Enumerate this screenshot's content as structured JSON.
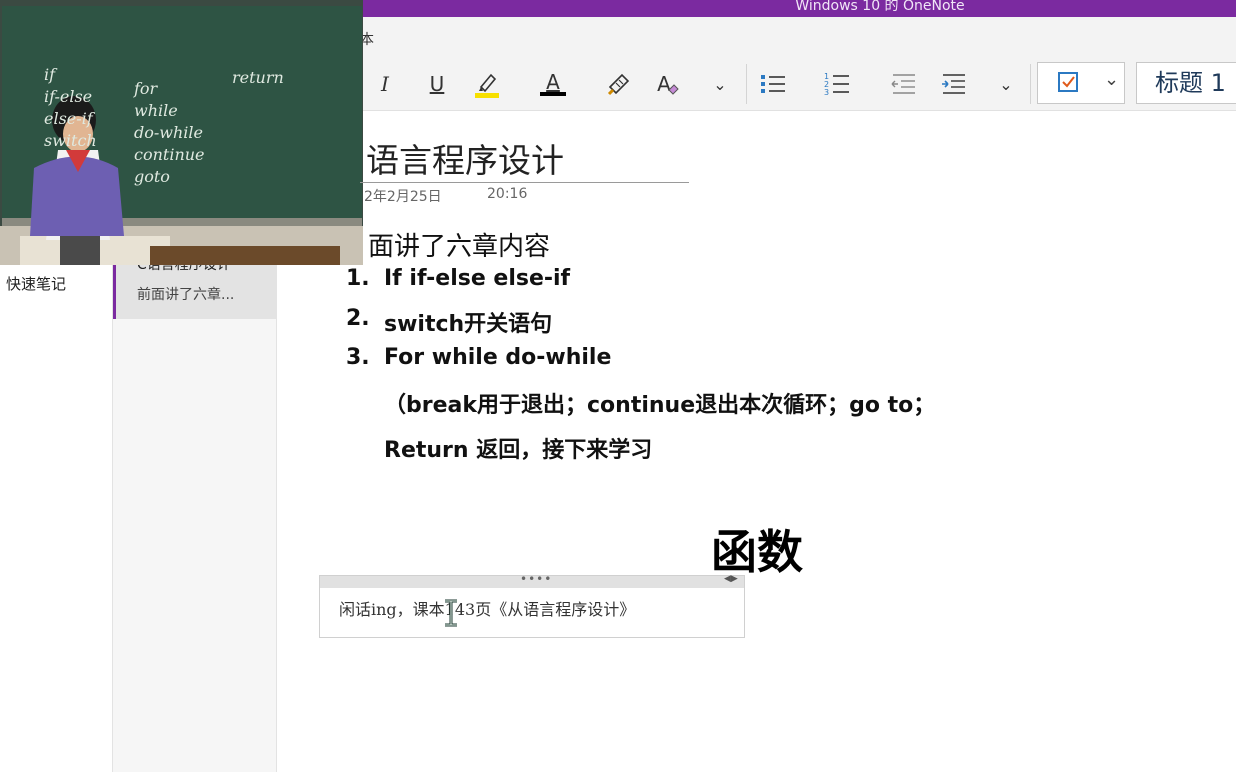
{
  "window": {
    "title": "Windows 10 的 OneNote"
  },
  "ribbon_tab": {
    "label": "本"
  },
  "toolbar": {
    "italic": "I",
    "underline": "U",
    "font_color": "A",
    "clear_format": "A",
    "more": "⌄",
    "more2": "⌄",
    "style_value": "标题 1",
    "highlight_color": "#f7e000",
    "font_color_value": "#000000"
  },
  "sections": {
    "items": [
      {
        "label": "快速笔记"
      }
    ]
  },
  "pages": {
    "selected": {
      "title": "C语言程序设计",
      "preview": "前面讲了六章..."
    }
  },
  "note": {
    "title": "语言程序设计",
    "date": "2年2月25日",
    "time": "20:16",
    "intro": "面讲了六章内容",
    "list": [
      {
        "num": "1.",
        "text": "If if-else else-if"
      },
      {
        "num": "2.",
        "text": "switch开关语句"
      },
      {
        "num": "3.",
        "text": "For while do-while"
      }
    ],
    "line4": "（break用于退出；continue退出本次循环；go to；",
    "line5": "Return 返回，接下来学习",
    "heading": "函数",
    "container_text": "闲话ing，课本143页《从语言程序设计》"
  },
  "video": {
    "board_left": [
      "if",
      "if-else",
      "else-if",
      "switch"
    ],
    "board_mid": [
      "for",
      "while",
      "do-while",
      "continue",
      "goto"
    ],
    "board_right": [
      "return"
    ]
  }
}
